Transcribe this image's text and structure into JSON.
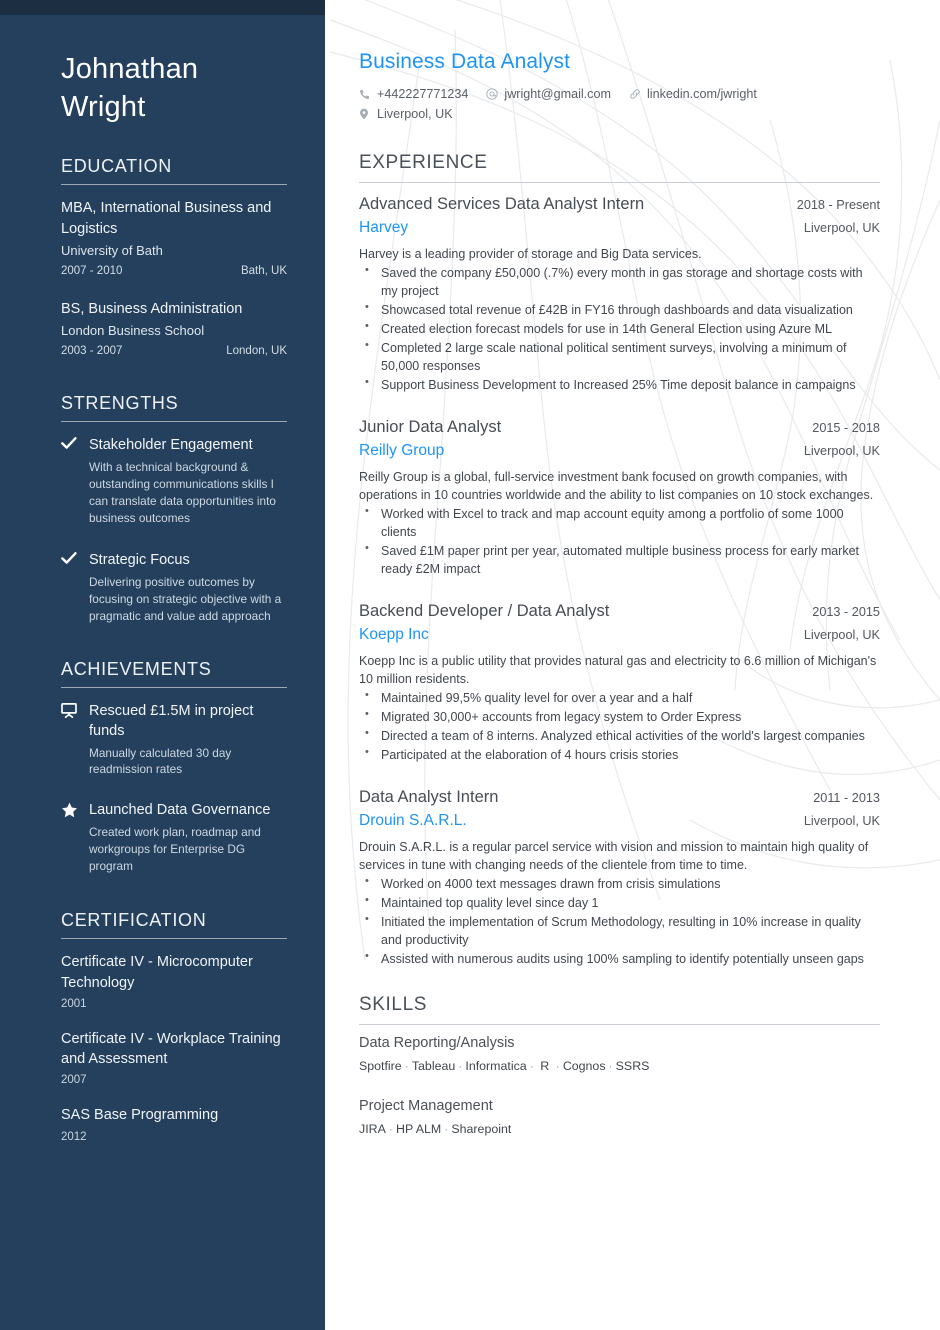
{
  "person": {
    "first_name": "Johnathan",
    "last_name": "Wright"
  },
  "header": {
    "job_title": "Business Data Analyst",
    "contacts": [
      {
        "icon": "phone-icon",
        "text": "+442227771234"
      },
      {
        "icon": "at-email-icon",
        "text": "jwright@gmail.com"
      },
      {
        "icon": "link-icon",
        "text": "linkedin.com/jwright"
      },
      {
        "icon": "map-pin-icon",
        "text": "Liverpool, UK"
      }
    ]
  },
  "colors": {
    "sidebar_bg": "#24405c",
    "topbar_bg": "#1b2e42",
    "accent_blue": "#1f94f7",
    "body_text": "#41474e",
    "rule": "#c9ced4"
  },
  "sidebar": {
    "education": {
      "heading": "EDUCATION",
      "items": [
        {
          "degree": "MBA, International Business and Logistics",
          "school": "University of Bath",
          "dates": "2007 - 2010",
          "location": "Bath, UK"
        },
        {
          "degree": "BS, Business Administration",
          "school": "London Business School",
          "dates": "2003 - 2007",
          "location": "London, UK"
        }
      ]
    },
    "strengths": {
      "heading": "STRENGTHS",
      "items": [
        {
          "icon": "check-icon",
          "title": "Stakeholder Engagement",
          "description": "With a technical background & outstanding communications skills I can translate data opportunities into business outcomes"
        },
        {
          "icon": "check-icon",
          "title": "Strategic Focus",
          "description": "Delivering positive outcomes by focusing on strategic objective with a pragmatic and value add approach"
        }
      ]
    },
    "achievements": {
      "heading": "ACHIEVEMENTS",
      "items": [
        {
          "icon": "presentation-easel-icon",
          "title": "Rescued £1.5M in project funds",
          "description": "Manually calculated 30 day readmission rates"
        },
        {
          "icon": "star-icon",
          "title": "Launched Data Governance",
          "description": "Created work plan, roadmap and workgroups for Enterprise DG program"
        }
      ]
    },
    "certification": {
      "heading": "CERTIFICATION",
      "items": [
        {
          "title": "Certificate IV - Microcomputer Technology",
          "year": "2001"
        },
        {
          "title": "Certificate IV - Workplace Training and Assessment",
          "year": "2007"
        },
        {
          "title": "SAS Base Programming",
          "year": "2012"
        }
      ]
    }
  },
  "main": {
    "experience": {
      "heading": "EXPERIENCE",
      "items": [
        {
          "position": "Advanced Services Data Analyst Intern",
          "company": "Harvey",
          "dates": "2018 - Present",
          "location": "Liverpool, UK",
          "summary": "Harvey is a leading provider of storage and Big Data services.",
          "bullets": [
            "Saved the company £50,000 (.7%) every month in gas storage and shortage costs with my project",
            "Showcased total revenue of £42B in FY16 through dashboards and data visualization",
            "Created election forecast models for use in 14th General Election using Azure ML",
            "Completed 2 large scale national political sentiment surveys, involving a minimum of 50,000 responses",
            "Support Business Development to Increased 25% Time deposit balance in campaigns"
          ]
        },
        {
          "position": "Junior Data Analyst",
          "company": "Reilly Group",
          "dates": "2015 - 2018",
          "location": "Liverpool, UK",
          "summary": "Reilly Group is a global, full-service investment bank focused on growth companies, with operations in 10 countries worldwide and the ability to list companies on 10 stock exchanges.",
          "bullets": [
            "Worked with Excel to track and map account equity among a portfolio of some 1000 clients",
            "Saved £1M paper print per year, automated multiple business process for early market ready £2M impact"
          ]
        },
        {
          "position": "Backend Developer / Data Analyst",
          "company": "Koepp Inc",
          "dates": "2013 - 2015",
          "location": "Liverpool, UK",
          "summary": "Koepp Inc is a public utility that provides natural gas and electricity to 6.6 million of Michigan's 10 million residents.",
          "bullets": [
            "Maintained 99,5% quality level for over a year and a half",
            "Migrated 30,000+ accounts from legacy system to Order Express",
            "Directed a team of 8 interns. Analyzed ethical activities of the world's largest companies",
            "Participated at the elaboration of 4 hours crisis stories"
          ]
        },
        {
          "position": "Data Analyst Intern",
          "company": "Drouin S.A.R.L.",
          "dates": "2011 - 2013",
          "location": "Liverpool, UK",
          "summary": "Drouin S.A.R.L. is a regular parcel service with vision and mission to maintain high quality of services in tune with changing needs of the clientele from time to time.",
          "bullets": [
            "Worked on 4000 text messages drawn from crisis simulations",
            "Maintained top quality level since day 1",
            "Initiated the implementation of Scrum Methodology, resulting in 10% increase in quality and productivity",
            "Assisted with numerous audits using 100% sampling to identify potentially unseen gaps"
          ]
        }
      ]
    },
    "skills": {
      "heading": "SKILLS",
      "groups": [
        {
          "category": "Data Reporting/Analysis",
          "items": [
            "Spotfire",
            "Tableau",
            "Informatica",
            " R ",
            "Cognos",
            "SSRS"
          ]
        },
        {
          "category": "Project Management",
          "items": [
            "JIRA",
            "HP ALM",
            "Sharepoint"
          ]
        }
      ]
    }
  }
}
